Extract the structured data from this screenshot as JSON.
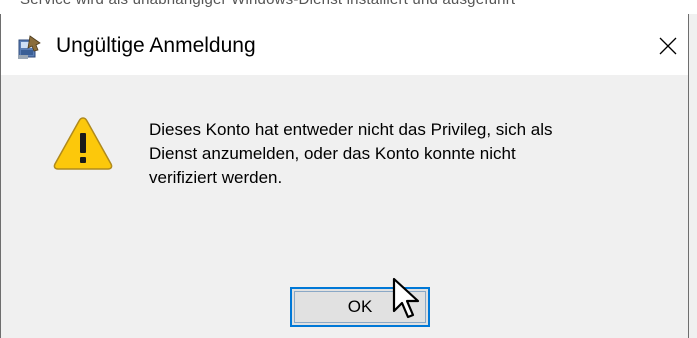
{
  "background": {
    "partial_text": "Service wird als unabhängiger Windows-Dienst installiert und ausgeführt"
  },
  "dialog": {
    "title": "Ungültige Anmeldung",
    "close_glyph": "✕",
    "message_lines": [
      "Dieses Konto hat entweder nicht das Privileg, sich als",
      "Dienst anzumelden, oder das Konto konnte nicht",
      "verifiziert werden."
    ],
    "ok_label": "OK",
    "icons": {
      "app": "installer-app-icon",
      "warning": "warning-icon",
      "cursor": "mouse-pointer-icon"
    },
    "colors": {
      "focus_border": "#0078d7",
      "button_face": "#e1e1e1",
      "content_bg": "#f0f0f0",
      "warning_fill": "#fcc80b"
    }
  }
}
